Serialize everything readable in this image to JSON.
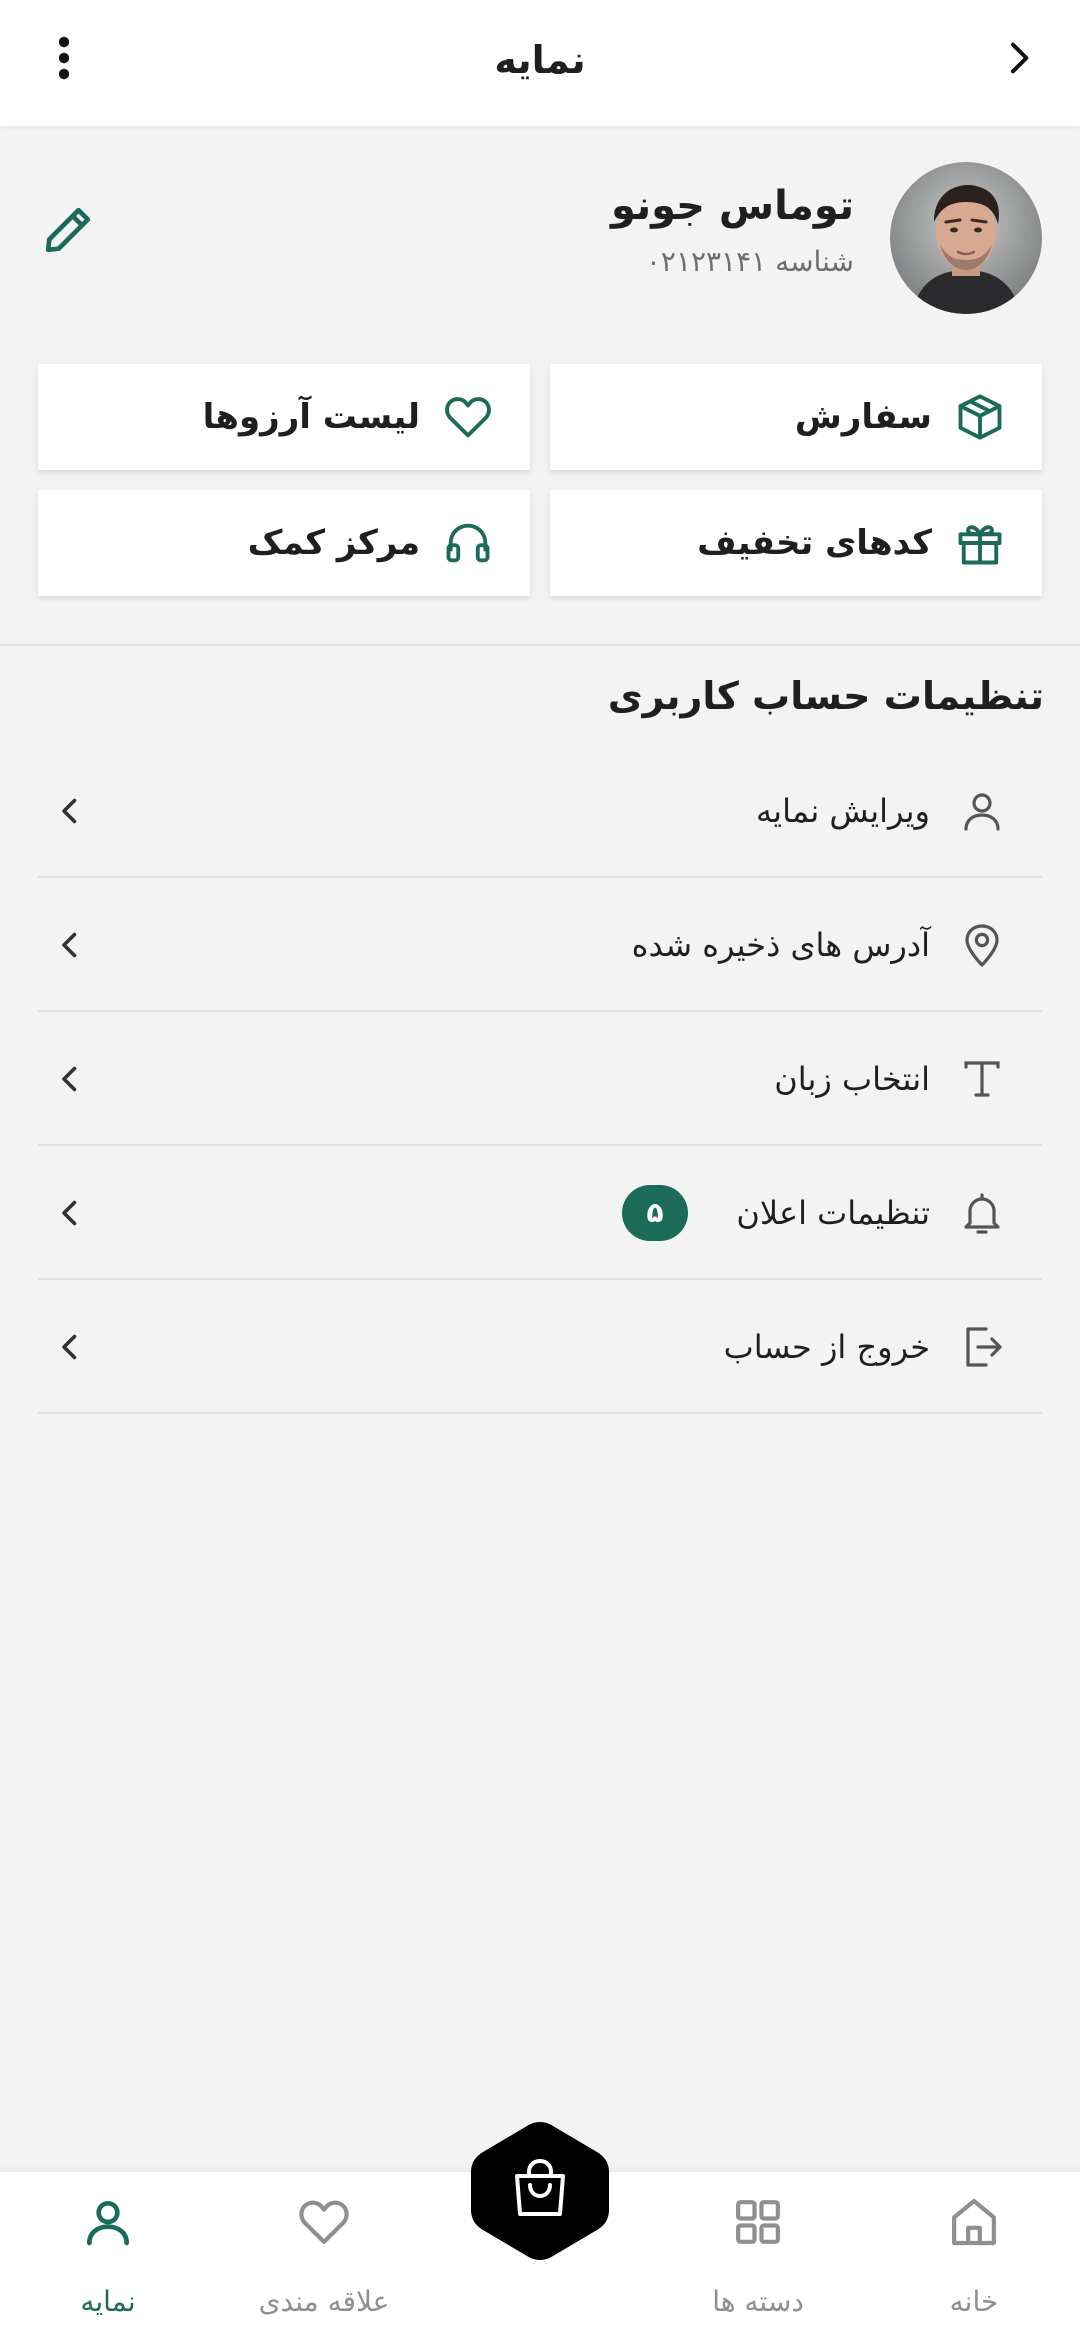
{
  "header": {
    "title": "نمایه",
    "back_icon": "chevron-right-icon",
    "menu_icon": "more-vertical-icon"
  },
  "profile": {
    "name": "توماس جونو",
    "id_text": "شناسه ۰۲۱۲۳۱۴۱",
    "edit_icon": "pencil-icon"
  },
  "quick_actions": [
    {
      "label": "سفارش",
      "icon": "box-icon"
    },
    {
      "label": "لیست آرزوها",
      "icon": "heart-icon"
    },
    {
      "label": "کدهای تخفیف",
      "icon": "gift-icon"
    },
    {
      "label": "مرکز کمک",
      "icon": "headphones-icon"
    }
  ],
  "settings": {
    "title": "تنظیمات حساب کاربری",
    "items": [
      {
        "label": "ویرایش نمایه",
        "icon": "user-icon"
      },
      {
        "label": "آدرس های ذخیره شده",
        "icon": "location-pin-icon"
      },
      {
        "label": "انتخاب زبان",
        "icon": "text-icon"
      },
      {
        "label": "تنظیمات اعلان",
        "icon": "bell-icon",
        "badge": "۵"
      },
      {
        "label": "خروج از حساب",
        "icon": "logout-icon"
      }
    ]
  },
  "bottom_nav": {
    "items": [
      {
        "label": "نمایه",
        "icon": "user-icon",
        "active": true
      },
      {
        "label": "علاقه مندی",
        "icon": "heart-icon",
        "active": false
      },
      {
        "label": "دسته ها",
        "icon": "grid-icon",
        "active": false
      },
      {
        "label": "خانه",
        "icon": "home-icon",
        "active": false
      }
    ],
    "cart_icon": "shopping-bag-icon"
  },
  "colors": {
    "accent": "#1c6b59",
    "background": "#f3f3f3",
    "surface": "#ffffff",
    "inactive": "#8f8f8f",
    "fab": "#000000"
  }
}
